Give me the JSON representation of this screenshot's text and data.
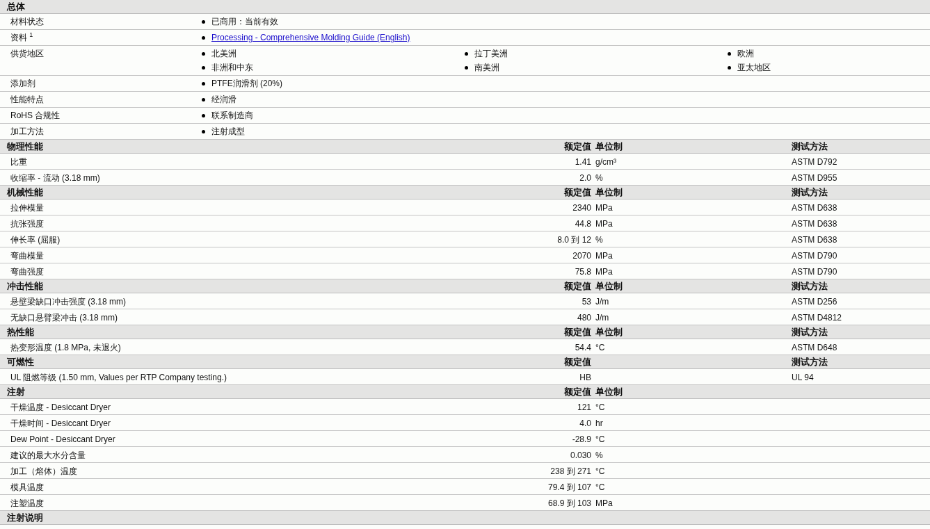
{
  "general": {
    "title": "总体",
    "rows": [
      {
        "label": "材料状态",
        "items": [
          {
            "kind": "text",
            "text": "已商用：当前有效"
          }
        ]
      },
      {
        "label": "资料 $^{1}$",
        "items": [
          {
            "kind": "link",
            "text": "Processing - Comprehensive Molding Guide (English)"
          }
        ]
      },
      {
        "label": "供货地区",
        "items": [
          {
            "kind": "text",
            "text": "北美洲"
          },
          {
            "kind": "text",
            "text": "拉丁美洲"
          },
          {
            "kind": "text",
            "text": "欧洲"
          },
          {
            "kind": "text",
            "text": "非洲和中东"
          },
          {
            "kind": "text",
            "text": "南美洲"
          },
          {
            "kind": "text",
            "text": "亚太地区"
          }
        ]
      },
      {
        "label": "添加剂",
        "items": [
          {
            "kind": "text",
            "text": "PTFE润滑剂  (20%)"
          }
        ]
      },
      {
        "label": "性能特点",
        "items": [
          {
            "kind": "text",
            "text": "经润滑"
          }
        ]
      },
      {
        "label": "RoHS 合规性",
        "items": [
          {
            "kind": "text",
            "text": "联系制造商"
          }
        ]
      },
      {
        "label": "加工方法",
        "items": [
          {
            "kind": "text",
            "text": "注射成型"
          }
        ]
      }
    ]
  },
  "sections": [
    {
      "title": "物理性能",
      "value_header": "额定值",
      "unit_header": "单位制",
      "method_header": "测试方法",
      "rows": [
        {
          "label": "比重",
          "value": "1.41",
          "unit": "g/cm³",
          "method": "ASTM D792"
        },
        {
          "label": "收缩率  - 流动  (3.18 mm)",
          "value": "2.0",
          "unit": "%",
          "method": "ASTM D955"
        }
      ]
    },
    {
      "title": "机械性能",
      "value_header": "额定值",
      "unit_header": "单位制",
      "method_header": "测试方法",
      "rows": [
        {
          "label": "拉伸模量",
          "value": "2340",
          "unit": "MPa",
          "method": "ASTM D638"
        },
        {
          "label": "抗张强度",
          "value": "44.8",
          "unit": "MPa",
          "method": "ASTM D638"
        },
        {
          "label": "伸长率  (屈服)",
          "value": "8.0 到  12",
          "unit": "%",
          "method": "ASTM D638"
        },
        {
          "label": "弯曲模量",
          "value": "2070",
          "unit": "MPa",
          "method": "ASTM D790"
        },
        {
          "label": "弯曲强度",
          "value": "75.8",
          "unit": "MPa",
          "method": "ASTM D790"
        }
      ]
    },
    {
      "title": "冲击性能",
      "value_header": "额定值",
      "unit_header": "单位制",
      "method_header": "测试方法",
      "rows": [
        {
          "label": "悬壁梁缺口冲击强度  (3.18 mm)",
          "value": "53",
          "unit": "J/m",
          "method": "ASTM D256"
        },
        {
          "label": "无缺口悬臂梁冲击  (3.18 mm)",
          "value": "480",
          "unit": "J/m",
          "method": "ASTM D4812"
        }
      ]
    },
    {
      "title": "热性能",
      "value_header": "额定值",
      "unit_header": "单位制",
      "method_header": "测试方法",
      "rows": [
        {
          "label": "热变形温度  (1.8 MPa, 未退火)",
          "value": "54.4",
          "unit": "°C",
          "method": "ASTM D648"
        }
      ]
    },
    {
      "title": "可燃性",
      "value_header": "额定值",
      "method_header": "测试方法",
      "rows": [
        {
          "label": "UL 阻燃等级  (1.50 mm, Values per RTP Company testing.)",
          "value": "HB",
          "method": "UL 94"
        }
      ]
    },
    {
      "title": "注射",
      "value_header": "额定值",
      "unit_header": "单位制",
      "rows": [
        {
          "label": "干燥温度  - Desiccant Dryer",
          "value": "121",
          "unit": "°C"
        },
        {
          "label": "干燥时间  - Desiccant Dryer",
          "value": "4.0",
          "unit": "hr"
        },
        {
          "label": "Dew Point - Desiccant Dryer",
          "value": "-28.9",
          "unit": "°C"
        },
        {
          "label": "建议的最大水分含量",
          "value": "0.030",
          "unit": "%"
        },
        {
          "label": "加工（熔体）温度",
          "value": "238 到  271",
          "unit": "°C"
        },
        {
          "label": "模具温度",
          "value": "79.4 到  107",
          "unit": "°C"
        },
        {
          "label": "注塑温度",
          "value": "68.9 到  103",
          "unit": "MPa"
        }
      ]
    },
    {
      "title": "注射说明"
    }
  ]
}
